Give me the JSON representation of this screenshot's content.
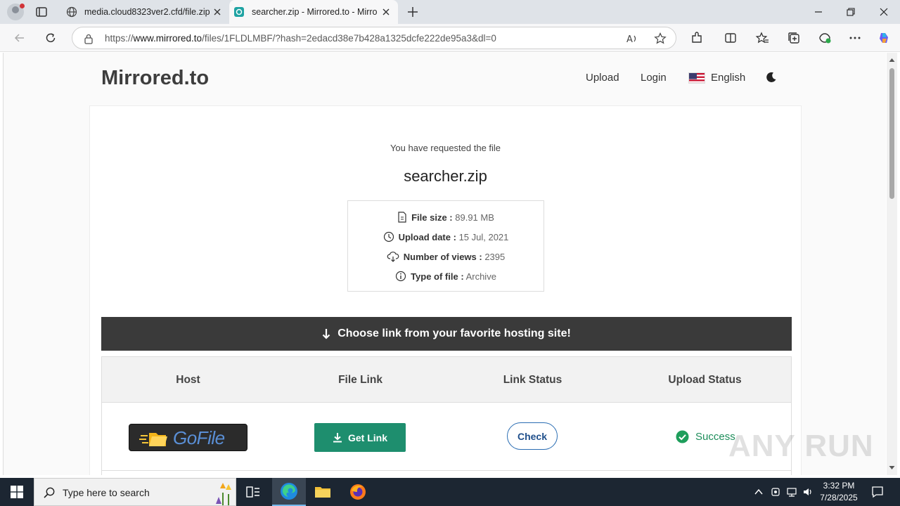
{
  "browser": {
    "tabs": [
      {
        "title": "media.cloud8323ver2.cfd/file.zip?",
        "active": false
      },
      {
        "title": "searcher.zip - Mirrored.to - Mirror",
        "active": true
      }
    ],
    "url_prefix": "https://",
    "url_host": "www.mirrored.to",
    "url_path": "/files/1FLDLMBF/?hash=2edacd38e7b428a1325dcfe222de95a3&dl=0"
  },
  "site": {
    "brand": "Mirrored.to",
    "nav": {
      "upload": "Upload",
      "login": "Login",
      "language": "English"
    }
  },
  "file": {
    "requested_label": "You have requested the file",
    "name": "searcher.zip",
    "info": [
      {
        "key": "File size :",
        "value": "89.91 MB",
        "icon": "file-icon"
      },
      {
        "key": "Upload date :",
        "value": "15 Jul, 2021",
        "icon": "clock-icon"
      },
      {
        "key": "Number of views :",
        "value": "2395",
        "icon": "cloud-download-icon"
      },
      {
        "key": "Type of file :",
        "value": "Archive",
        "icon": "info-icon"
      }
    ]
  },
  "hosts": {
    "banner": "Choose link from your favorite hosting site!",
    "columns": [
      "Host",
      "File Link",
      "Link Status",
      "Upload Status"
    ],
    "rows": [
      {
        "host": "GoFile",
        "link_label": "Get Link",
        "status_label": "Check",
        "upload_status": "Success"
      }
    ]
  },
  "watermark": "ANY RUN",
  "taskbar": {
    "search_placeholder": "Type here to search",
    "time": "3:32 PM",
    "date": "7/28/2025"
  },
  "colors": {
    "accent_green": "#1e8e6e",
    "banner_dark": "#3a3a3a",
    "check_blue": "#2a6db3"
  }
}
